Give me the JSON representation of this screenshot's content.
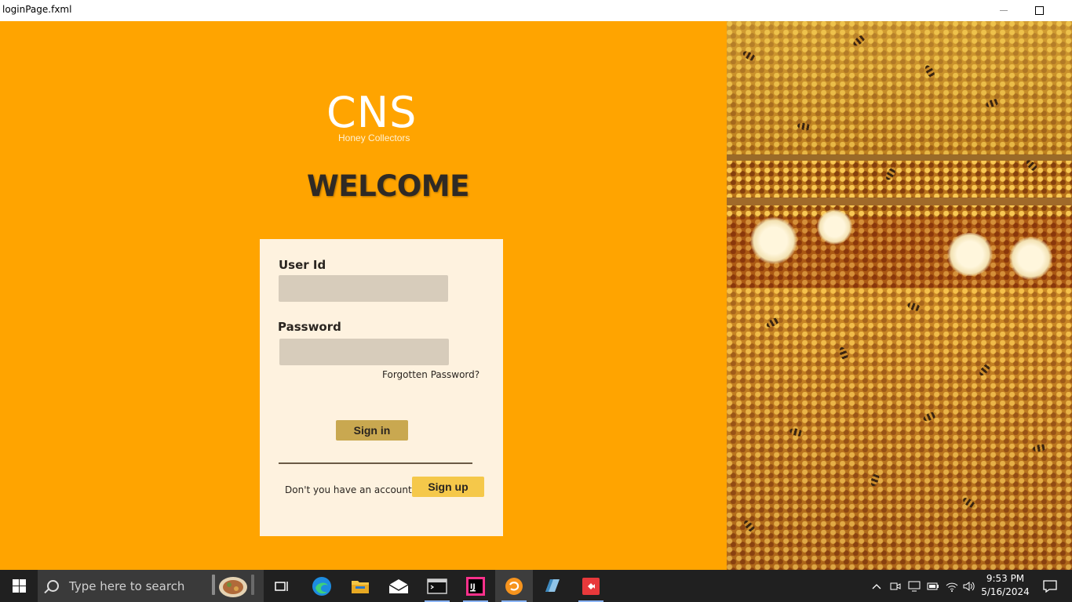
{
  "window": {
    "title": "loginPage.fxml",
    "minimize_icon": "minimize-icon",
    "maximize_icon": "maximize-icon"
  },
  "brand": {
    "logo_text": "CNS",
    "tagline": "Honey Collectors"
  },
  "welcome": "WELCOME",
  "login_form": {
    "user_label": "User Id",
    "user_value": "",
    "password_label": "Password",
    "password_value": "",
    "forgot_link": "Forgotten Password?",
    "signin_label": "Sign in",
    "no_account_text": "Don't you have an account?",
    "signup_label": "Sign up"
  },
  "colors": {
    "left_panel": "#FFA400",
    "card": "#FEF2DF",
    "field": "#D7CCBB",
    "signin_button": "#C9A850",
    "signup_button": "#F5C84A"
  },
  "taskbar": {
    "search_placeholder": "Type here to search",
    "apps": [
      "task-view-icon",
      "edge-icon",
      "file-explorer-icon",
      "mail-icon",
      "terminal-icon",
      "intellij-icon",
      "scene-builder-icon",
      "java-app-icon",
      "git-icon"
    ],
    "time": "9:53 PM",
    "date": "5/16/2024"
  }
}
